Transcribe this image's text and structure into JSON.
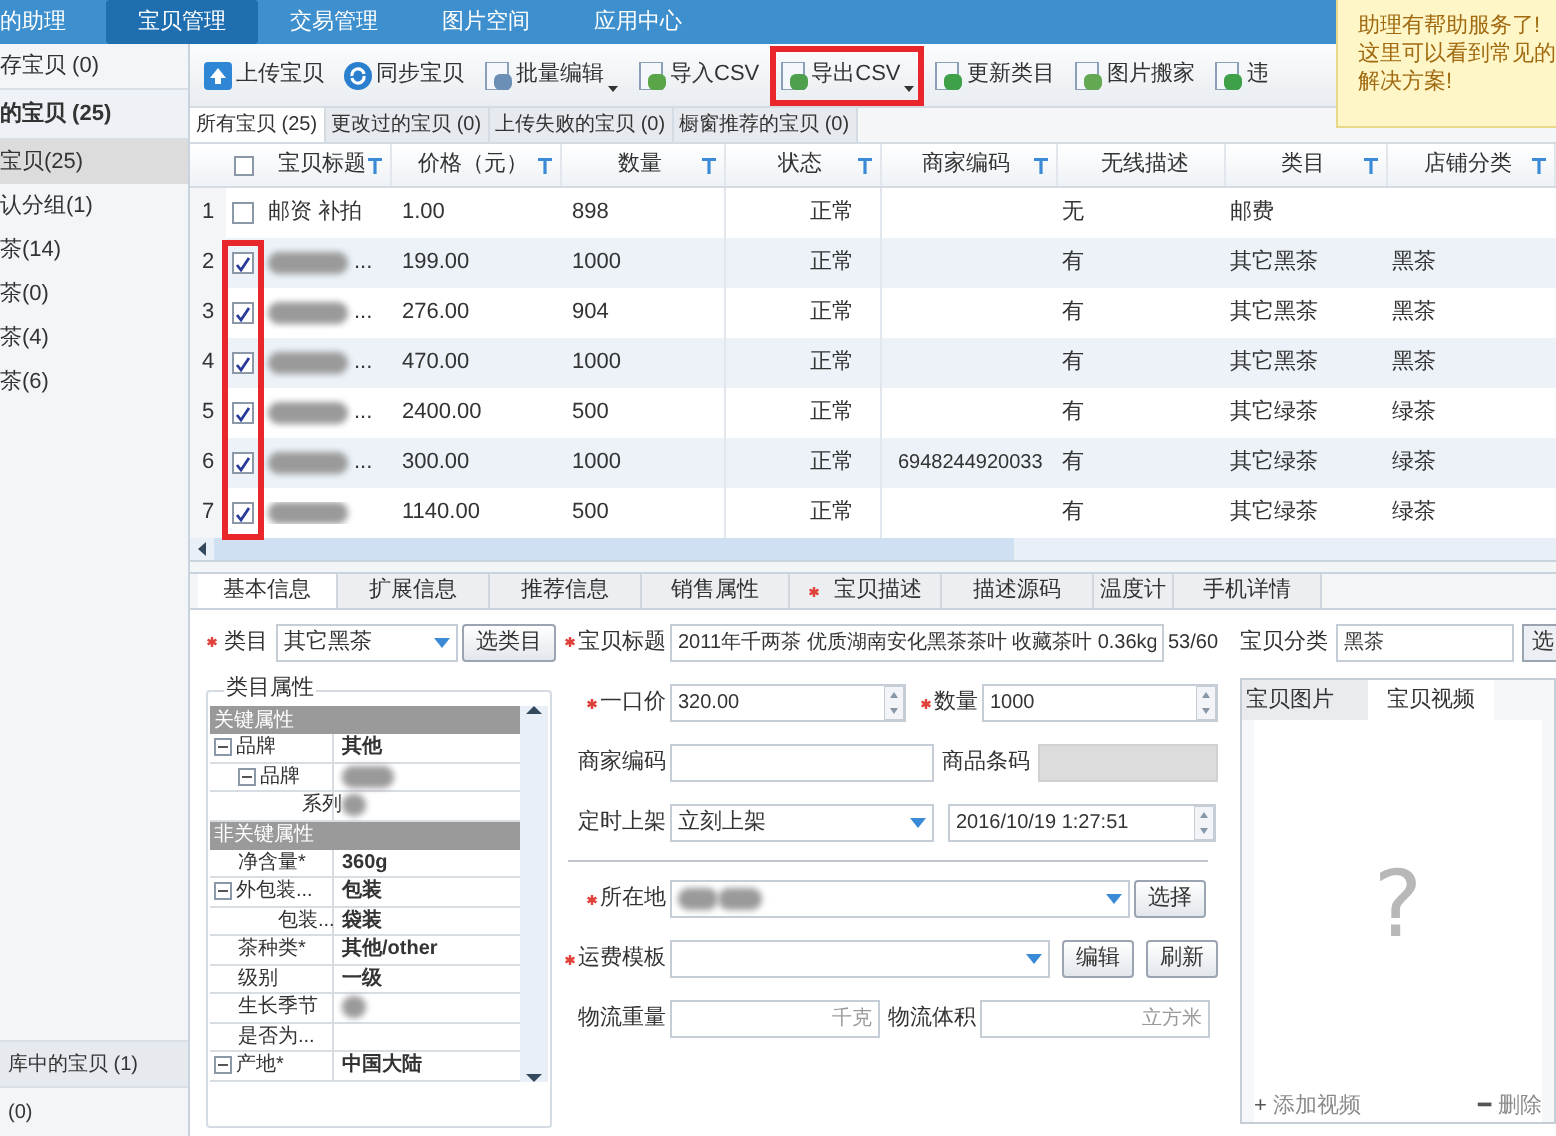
{
  "nav_tabs": [
    {
      "label": "的助理",
      "selected": false
    },
    {
      "label": "宝贝管理",
      "selected": true
    },
    {
      "label": "交易管理",
      "selected": false
    },
    {
      "label": "图片空间",
      "selected": false
    },
    {
      "label": "应用中心",
      "selected": false
    }
  ],
  "sidebar": {
    "items": [
      {
        "label": "存宝贝 (0)",
        "kind": "plain",
        "selected": false
      },
      {
        "label": "的宝贝 (25)",
        "kind": "heading",
        "selected": false
      },
      {
        "label": "宝贝(25)",
        "kind": "plain",
        "selected": true
      },
      {
        "label": "认分组(1)",
        "kind": "plain",
        "selected": false
      },
      {
        "label": "茶(14)",
        "kind": "plain",
        "selected": false
      },
      {
        "label": "茶(0)",
        "kind": "plain",
        "selected": false
      },
      {
        "label": "茶(4)",
        "kind": "plain",
        "selected": false
      },
      {
        "label": "茶(6)",
        "kind": "plain",
        "selected": false
      }
    ],
    "footer_items": [
      {
        "label": "库中的宝贝 (1)",
        "selected": true
      },
      {
        "label": "(0)",
        "selected": false
      }
    ]
  },
  "help_tip": {
    "lines": [
      "助理有帮助服务了!",
      "这里可以看到常见的",
      "解决方案!"
    ]
  },
  "toolbar": [
    {
      "label": "上传宝贝",
      "kind": "upload",
      "dropdown": false,
      "highlighted": false
    },
    {
      "label": "同步宝贝",
      "kind": "sync",
      "dropdown": false,
      "highlighted": false
    },
    {
      "label": "批量编辑",
      "kind": "document",
      "dropdown": true,
      "highlighted": false
    },
    {
      "label": "导入CSV",
      "kind": "document",
      "dropdown": false,
      "highlighted": false
    },
    {
      "label": "导出CSV",
      "kind": "document",
      "dropdown": true,
      "highlighted": true
    },
    {
      "label": "更新类目",
      "kind": "document",
      "dropdown": false,
      "highlighted": false
    },
    {
      "label": "图片搬家",
      "kind": "document",
      "dropdown": false,
      "highlighted": false
    },
    {
      "label": "违",
      "kind": "document",
      "dropdown": false,
      "highlighted": false
    }
  ],
  "sub_tabs": [
    {
      "label": "所有宝贝 (25)",
      "selected": true
    },
    {
      "label": "更改过的宝贝 (0)",
      "selected": false
    },
    {
      "label": "上传失败的宝贝 (0)",
      "selected": false
    },
    {
      "label": "橱窗推荐的宝贝 (0)",
      "selected": false
    }
  ],
  "table": {
    "checkbox_column_highlighted": true,
    "header_checked": false,
    "columns": [
      {
        "label": "宝贝标题",
        "filter": true
      },
      {
        "label": "价格（元）",
        "filter": true
      },
      {
        "label": "数量",
        "filter": true
      },
      {
        "label": "状态",
        "filter": true
      },
      {
        "label": "商家编码",
        "filter": true
      },
      {
        "label": "无线描述",
        "filter": false
      },
      {
        "label": "类目",
        "filter": true
      },
      {
        "label": "店铺分类",
        "filter": true
      }
    ],
    "rows": [
      {
        "num": "1",
        "checked": false,
        "title": "邮资 补拍",
        "redacted": false,
        "price": "1.00",
        "quantity": "898",
        "status": "正常",
        "wireless": "无",
        "category": "邮费"
      },
      {
        "num": "2",
        "checked": true,
        "title": "...",
        "redacted": true,
        "price": "199.00",
        "quantity": "1000",
        "status": "正常",
        "wireless": "有",
        "category": "其它黑茶",
        "shop_category": "黑茶"
      },
      {
        "num": "3",
        "checked": true,
        "title": "...",
        "redacted": true,
        "price": "276.00",
        "quantity": "904",
        "status": "正常",
        "wireless": "有",
        "category": "其它黑茶",
        "shop_category": "黑茶"
      },
      {
        "num": "4",
        "checked": true,
        "title": "...",
        "redacted": true,
        "price": "470.00",
        "quantity": "1000",
        "status": "正常",
        "wireless": "有",
        "category": "其它黑茶",
        "shop_category": "黑茶"
      },
      {
        "num": "5",
        "checked": true,
        "title": "...",
        "redacted": true,
        "price": "2400.00",
        "quantity": "500",
        "status": "正常",
        "wireless": "有",
        "category": "其它绿茶",
        "shop_category": "绿茶"
      },
      {
        "num": "6",
        "checked": true,
        "title": "...",
        "redacted": true,
        "price": "300.00",
        "quantity": "1000",
        "status": "正常",
        "code": "6948244920033",
        "wireless": "有",
        "category": "其它绿茶",
        "shop_category": "绿茶"
      },
      {
        "num": "7",
        "checked": true,
        "redacted": true,
        "price": "1140.00",
        "quantity": "500",
        "status": "正常",
        "wireless": "有",
        "category": "其它绿茶",
        "shop_category": "绿茶"
      }
    ]
  },
  "detail_tabs": [
    {
      "label": "基本信息",
      "selected": true,
      "required": false
    },
    {
      "label": "扩展信息",
      "selected": false,
      "required": false
    },
    {
      "label": "推荐信息",
      "selected": false,
      "required": false
    },
    {
      "label": "销售属性",
      "selected": false,
      "required": false
    },
    {
      "label": "宝贝描述",
      "selected": false,
      "required": true
    },
    {
      "label": "描述源码",
      "selected": false,
      "required": false
    },
    {
      "label": "温度计",
      "selected": false,
      "required": false
    },
    {
      "label": "手机详情",
      "selected": false,
      "required": false
    }
  ],
  "category": {
    "label": "类目",
    "value": "其它黑茶",
    "button": "选类目"
  },
  "attributes": {
    "title": "类目属性",
    "groups": [
      {
        "label": "关键属性",
        "items": [
          {
            "name": "品牌",
            "value": "其他",
            "expanded": true,
            "children": [
              {
                "name": "品牌",
                "redacted": true,
                "expanded": true,
                "children": [
                  {
                    "name": "系列",
                    "redacted": true
                  }
                ]
              }
            ]
          }
        ]
      },
      {
        "label": "非关键属性",
        "items": [
          {
            "name": "净含量*",
            "value": "360g"
          },
          {
            "name": "外包装...",
            "value": "包装",
            "expanded": true,
            "children": [
              {
                "name": "包装...",
                "value": "袋装"
              }
            ]
          },
          {
            "name": "茶种类*",
            "value": "其他/other"
          },
          {
            "name": "级别",
            "value": "一级"
          },
          {
            "name": "生长季节",
            "redacted": true
          },
          {
            "name": "是否为...",
            "redacted": false
          },
          {
            "name": "产地*",
            "value": "中国大陆",
            "expanded": true
          }
        ]
      }
    ]
  },
  "form": {
    "title": {
      "label": "宝贝标题",
      "value": "2011年千两茶 优质湖南安化黑茶茶叶 收藏茶叶 0.36kg",
      "counter": "53/60"
    },
    "price": {
      "label": "一口价",
      "value": "320.00"
    },
    "quantity": {
      "label": "数量",
      "value": "1000"
    },
    "merchant_code": {
      "label": "商家编码"
    },
    "barcode": {
      "label": "商品条码",
      "disabled": true
    },
    "listing": {
      "label": "定时上架",
      "value": "立刻上架",
      "datetime": "2016/10/19 1:27:51"
    },
    "location": {
      "label": "所在地",
      "redacted": true,
      "button": "选择"
    },
    "shipping": {
      "label": "运费模板",
      "buttons": [
        "编辑",
        "刷新"
      ]
    },
    "weight": {
      "label": "物流重量",
      "placeholder": "千克"
    },
    "volume": {
      "label": "物流体积",
      "placeholder": "立方米"
    },
    "shop_category": {
      "label": "宝贝分类",
      "value": "黑茶",
      "button": "选"
    }
  },
  "media": {
    "tabs": [
      {
        "label": "宝贝图片",
        "selected": false
      },
      {
        "label": "宝贝视频",
        "selected": true
      }
    ],
    "placeholder_mark": "?",
    "actions": [
      {
        "icon": "+",
        "label": "添加视频"
      },
      {
        "icon": "━",
        "label": "删除"
      }
    ]
  }
}
